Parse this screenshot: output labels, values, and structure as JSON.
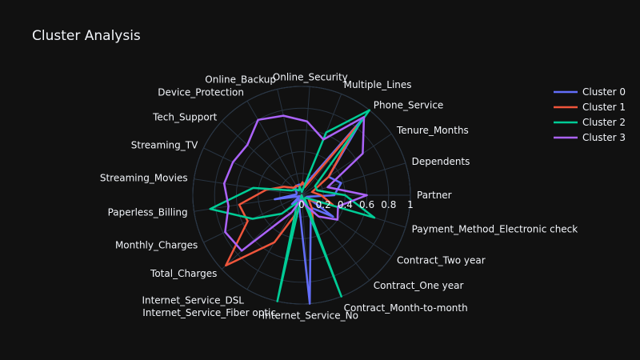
{
  "chart_data": {
    "type": "radar",
    "title": "Cluster Analysis",
    "radial_range": [
      0,
      1
    ],
    "radial_ticks": [
      "0",
      "0.2",
      "0.4",
      "0.6",
      "0.8",
      "1"
    ],
    "grid": true,
    "legend_position": "top-right",
    "categories": [
      "Partner",
      "Dependents",
      "Tenure_Months",
      "Phone_Service",
      "Multiple_Lines",
      "Online_Security",
      "Online_Backup",
      "Device_Protection",
      "Tech_Support",
      "Streaming_TV",
      "Streaming_Movies",
      "Paperless_Billing",
      "Monthly_Charges",
      "Total_Charges",
      "Internet_Service_DSL",
      "Internet_Service_Fiber optic",
      "Internet_Service_No",
      "Contract_Month-to-month",
      "Contract_One year",
      "Contract_Two year",
      "Payment_Method_Electronic check"
    ],
    "series": [
      {
        "name": "Cluster 0",
        "color": "#636efa",
        "values": [
          0.3,
          0.38,
          0.3,
          0.9,
          0.12,
          0.1,
          0.1,
          0.1,
          0.08,
          0.05,
          0.05,
          0.25,
          0.02,
          0.12,
          0.04,
          0.1,
          1.0,
          0.23,
          0.15,
          0.35,
          0.05
        ]
      },
      {
        "name": "Cluster 1",
        "color": "#ef553b",
        "values": [
          0.18,
          0.1,
          0.3,
          0.8,
          0.08,
          0.12,
          0.08,
          0.1,
          0.1,
          0.18,
          0.33,
          0.58,
          0.55,
          0.95,
          0.5,
          0.15,
          0.0,
          0.3,
          0.15,
          0.08,
          0.3
        ]
      },
      {
        "name": "Cluster 2",
        "color": "#00cc96",
        "values": [
          0.4,
          0.15,
          0.15,
          1.0,
          0.62,
          0.03,
          0.08,
          0.05,
          0.08,
          0.1,
          0.45,
          0.85,
          0.5,
          0.25,
          0.08,
          1.0,
          0.0,
          1.0,
          0.05,
          0.04,
          0.7
        ]
      },
      {
        "name": "Cluster 3",
        "color": "#ab63fa",
        "values": [
          0.6,
          0.25,
          0.68,
          0.92,
          0.55,
          0.68,
          0.75,
          0.8,
          0.68,
          0.7,
          0.72,
          0.68,
          0.78,
          0.75,
          0.18,
          0.05,
          0.05,
          0.1,
          0.25,
          0.4,
          0.35
        ]
      }
    ]
  }
}
